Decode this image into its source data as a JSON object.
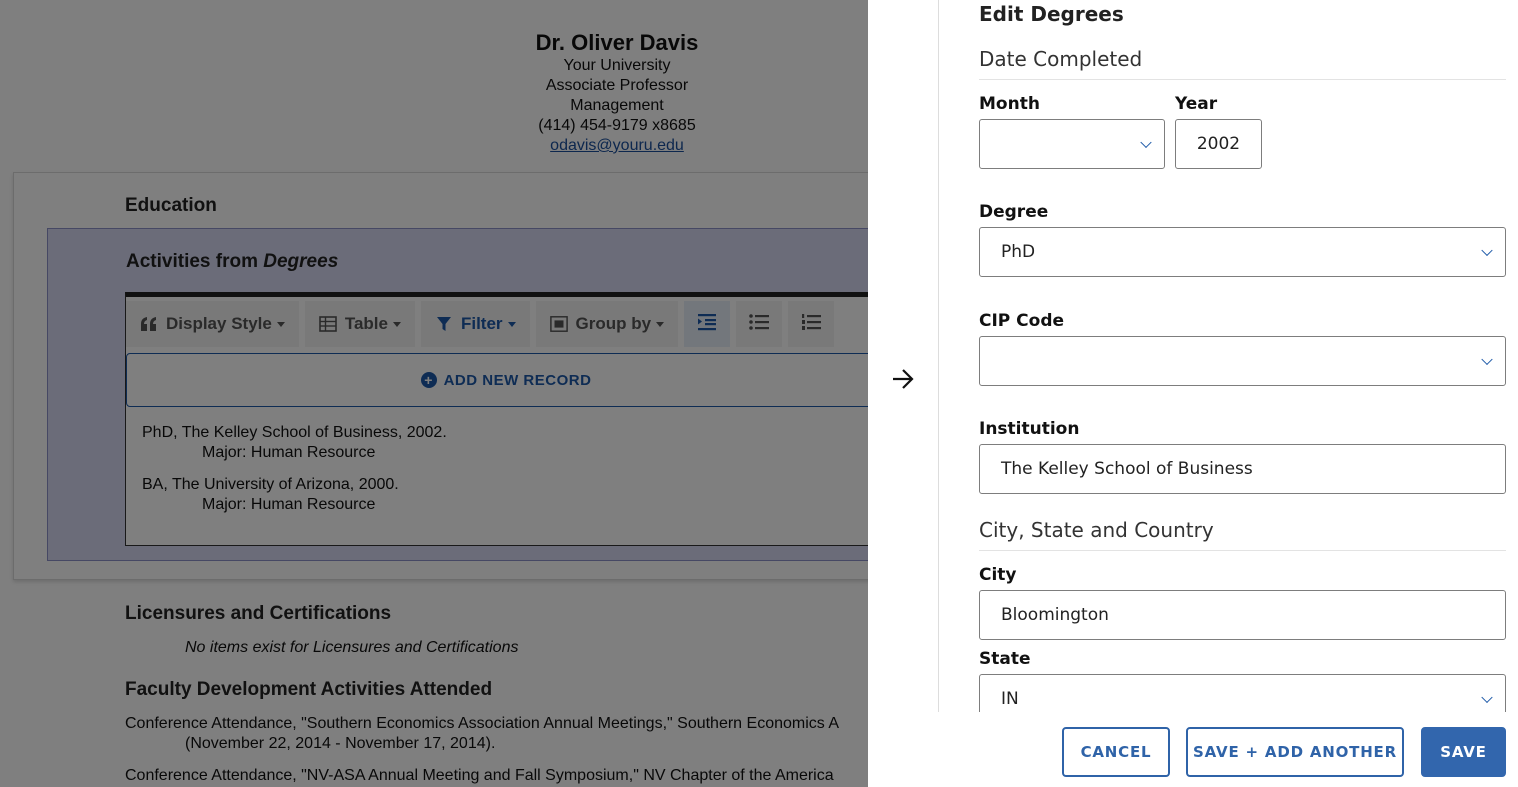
{
  "profile": {
    "name": "Dr. Oliver Davis",
    "university": "Your University",
    "title": "Associate Professor",
    "department": "Management",
    "phone": "(414) 454-9179 x8685",
    "email": "odavis@youru.edu"
  },
  "education": {
    "title": "Education",
    "activities_prefix": "Activities from ",
    "activities_source": "Degrees",
    "toolbar": {
      "display_style": "Display Style",
      "table": "Table",
      "filter": "Filter",
      "group_by": "Group by"
    },
    "add_new_record": "ADD NEW RECORD",
    "records": [
      {
        "line": "PhD, The Kelley School of Business, 2002.",
        "major": "Major: Human Resource"
      },
      {
        "line": "BA, The University of Arizona, 2000.",
        "major": "Major: Human Resource"
      }
    ]
  },
  "licensures": {
    "title": "Licensures and Certifications",
    "empty": "No items exist for Licensures and Certifications"
  },
  "faculty_dev": {
    "title": "Faculty Development Activities Attended",
    "items": [
      {
        "line": "Conference Attendance, \"Southern Economics Association Annual Meetings,\" Southern Economics A",
        "cont": "(November 22, 2014 - November 17, 2014)."
      },
      {
        "line": "Conference Attendance, \"NV-ASA Annual Meeting and Fall Symposium,\" NV Chapter of the America",
        "cont": ""
      }
    ]
  },
  "form": {
    "title": "Edit Degrees",
    "date_completed": "Date Completed",
    "month_label": "Month",
    "month_value": "",
    "year_label": "Year",
    "year_value": "2002",
    "degree_label": "Degree",
    "degree_value": "PhD",
    "cip_label": "CIP Code",
    "cip_value": "",
    "institution_label": "Institution",
    "institution_value": "The Kelley School of Business",
    "location_head": "City, State and Country",
    "city_label": "City",
    "city_value": "Bloomington",
    "state_label": "State",
    "state_value": "IN"
  },
  "actions": {
    "cancel": "CANCEL",
    "save_add": "SAVE + ADD ANOTHER",
    "save": "SAVE"
  },
  "colors": {
    "accent": "#1d59a8",
    "primary_button": "#3266ad",
    "activities_bg": "#d7d8f3"
  }
}
